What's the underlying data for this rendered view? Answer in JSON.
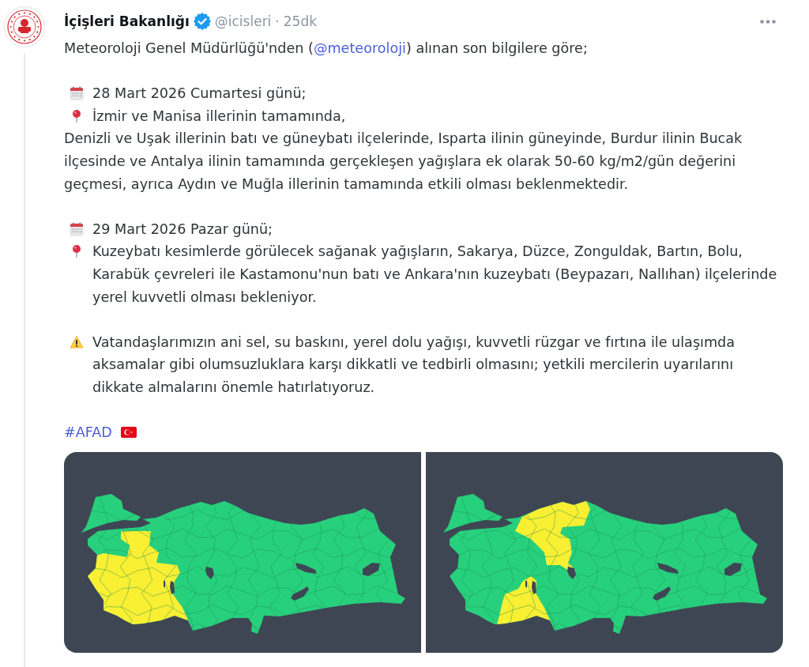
{
  "author": {
    "name": "İçişleri Bakanlığı",
    "verified": true,
    "handle": "@icisleri",
    "separator": "·",
    "time": "25dk"
  },
  "intro": {
    "before": "Meteoroloji Genel Müdürlüğü'nden (",
    "mention": "@meteoroloji",
    "after": ") alınan son bilgilere göre;"
  },
  "sections": [
    {
      "lines": [
        {
          "kind": "date",
          "text": "28 Mart 2026 Cumartesi günü;"
        },
        {
          "kind": "place",
          "text": "İzmir ve Manisa illerinin tamamında,"
        },
        {
          "kind": "plain",
          "text": "Denizli ve Uşak illerinin batı ve güneybatı ilçelerinde, Isparta ilinin güneyinde, Burdur ilinin Bucak ilçesinde ve Antalya ilinin tamamında gerçekleşen yağışlara ek olarak 50-60 kg/m2/gün değerini geçmesi, ayrıca Aydın ve Muğla illerinin tamamında etkili olması beklenmektedir."
        }
      ]
    },
    {
      "lines": [
        {
          "kind": "date",
          "text": "29 Mart 2026 Pazar günü;"
        },
        {
          "kind": "place",
          "text": "Kuzeybatı kesimlerde görülecek sağanak yağışların, Sakarya, Düzce, Zonguldak, Bartın, Bolu, Karabük çevreleri ile Kastamonu'nun batı ve Ankara'nın kuzeybatı (Beypazarı, Nallıhan) ilçelerinde yerel kuvvetli olması bekleniyor."
        }
      ]
    },
    {
      "lines": [
        {
          "kind": "warning",
          "text": "Vatandaşlarımızın ani sel, su baskını, yerel dolu yağışı, kuvvetli rüzgar ve fırtına ile ulaşımda aksamalar gibi olumsuzluklara karşı dikkatli ve tedbirli olmasını; yetkili mercilerin uyarılarını dikkate almalarını önemle hatırlatıyoruz."
        }
      ]
    }
  ],
  "hashtag": {
    "text": "#AFAD",
    "flag": true
  },
  "media": [
    {
      "kind": "map"
    },
    {
      "kind": "map"
    }
  ]
}
